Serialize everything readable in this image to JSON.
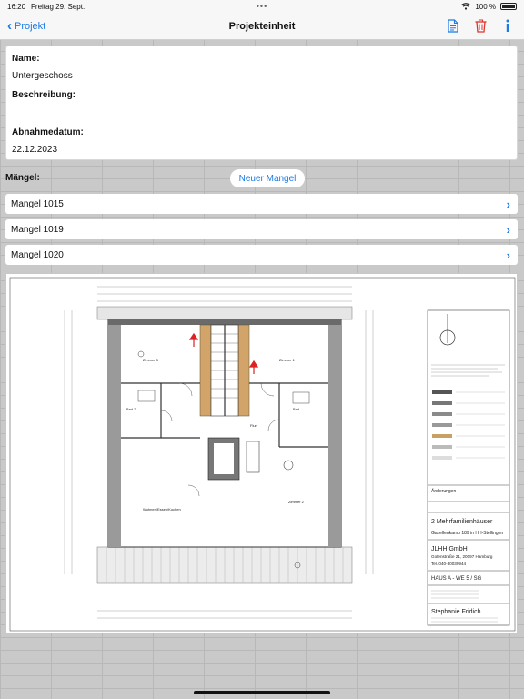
{
  "status_bar": {
    "time": "16:20",
    "date": "Freitag 29. Sept.",
    "battery_text": "100 %"
  },
  "nav": {
    "back_label": "Projekt",
    "title": "Projekteinheit",
    "actions": [
      "document-icon",
      "trash-icon",
      "info-icon"
    ]
  },
  "colors": {
    "accent": "#1a7ae6",
    "delete": "#e0342b"
  },
  "info": {
    "name_label": "Name:",
    "name_value": "Untergeschoss",
    "description_label": "Beschreibung:",
    "description_value": "",
    "acceptance_label": "Abnahmedatum:",
    "acceptance_value": "22.12.2023"
  },
  "defects": {
    "label": "Mängel:",
    "new_button": "Neuer Mangel",
    "items": [
      {
        "label": "Mangel 1015"
      },
      {
        "label": "Mangel 1019"
      },
      {
        "label": "Mangel 1020"
      }
    ]
  },
  "plan": {
    "title_block": {
      "heading": "Änderungen",
      "project_title": "2 Mehrfamilienhäuser",
      "project_subtitle": "Gazellenkamp 189 in HH-Stellingen",
      "company": "JLHH GmbH",
      "address": "Gotenstraße 21, 20097 Hamburg",
      "phone": "Tel. 040-30039944",
      "sheet": "HAUS A - WE 5 / SG",
      "architect": "Stephanie Fridich"
    }
  }
}
